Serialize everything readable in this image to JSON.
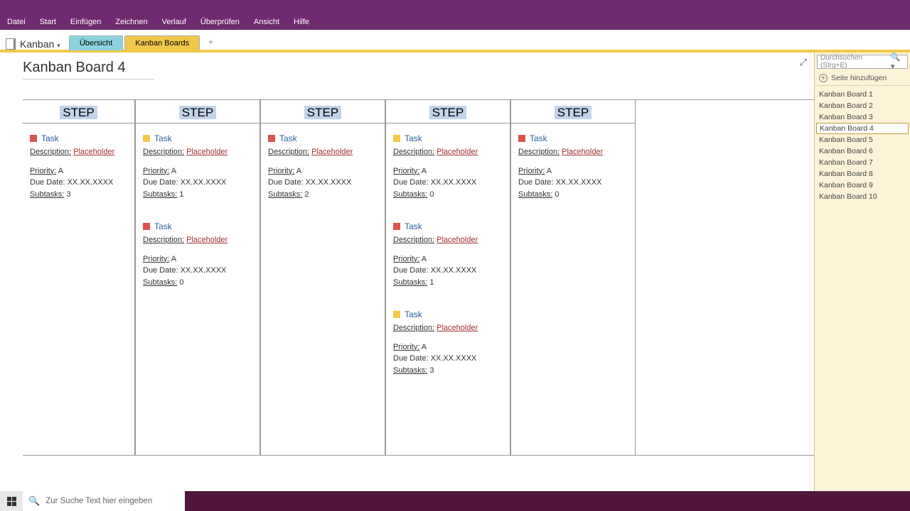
{
  "menu": [
    "Datei",
    "Start",
    "Einfügen",
    "Zeichnen",
    "Verlauf",
    "Überprüfen",
    "Ansicht",
    "Hilfe"
  ],
  "notebook": "Kanban",
  "sectionTabs": [
    {
      "label": "Übersicht",
      "cls": "active1"
    },
    {
      "label": "Kanban Boards",
      "cls": "active2"
    }
  ],
  "pageTitle": "Kanban Board 4",
  "search": {
    "placeholder": "Durchsuchen (Strg+E)"
  },
  "addPage": "Seite hinzufügen",
  "pages": [
    "Kanban Board 1",
    "Kanban Board 2",
    "Kanban Board 3",
    "Kanban Board 4",
    "Kanban Board 5",
    "Kanban Board 6",
    "Kanban Board 7",
    "Kanban Board 8",
    "Kanban Board 9",
    "Kanban Board 10"
  ],
  "selectedPage": 3,
  "columns": [
    {
      "header": "STEP",
      "tasks": [
        {
          "color": "red",
          "title": "Task",
          "desc": "Placeholder",
          "priority": "A",
          "due": "XX.XX.XXXX",
          "subtasks": "3"
        }
      ]
    },
    {
      "header": "STEP",
      "tasks": [
        {
          "color": "yellow",
          "title": "Task",
          "desc": "Placeholder",
          "priority": "A",
          "due": "XX.XX.XXXX",
          "subtasks": "1"
        },
        {
          "color": "red",
          "title": "Task",
          "desc": "Placeholder",
          "priority": "A",
          "due": "XX.XX.XXXX",
          "subtasks": "0"
        }
      ]
    },
    {
      "header": "STEP",
      "tasks": [
        {
          "color": "red",
          "title": "Task",
          "desc": "Placeholder",
          "priority": "A",
          "due": "XX.XX.XXXX",
          "subtasks": "2"
        }
      ]
    },
    {
      "header": "STEP",
      "tasks": [
        {
          "color": "yellow",
          "title": "Task",
          "desc": "Placeholder",
          "priority": "A",
          "due": "XX.XX.XXXX",
          "subtasks": "0"
        },
        {
          "color": "red",
          "title": "Task",
          "desc": "Placeholder",
          "priority": "A",
          "due": "XX.XX.XXXX",
          "subtasks": "1"
        },
        {
          "color": "yellow",
          "title": "Task",
          "desc": "Placeholder",
          "priority": "A",
          "due": "XX.XX.XXXX",
          "subtasks": "3"
        }
      ]
    },
    {
      "header": "STEP",
      "tasks": [
        {
          "color": "red",
          "title": "Task",
          "desc": "Placeholder",
          "priority": "A",
          "due": "XX.XX.XXXX",
          "subtasks": "0"
        }
      ]
    }
  ],
  "labels": {
    "description": "Description",
    "priority": "Priority",
    "dueDate": "Due Date",
    "subtasks": "Subtasks"
  },
  "taskbar": {
    "searchPlaceholder": "Zur Suche Text hier eingeben"
  }
}
